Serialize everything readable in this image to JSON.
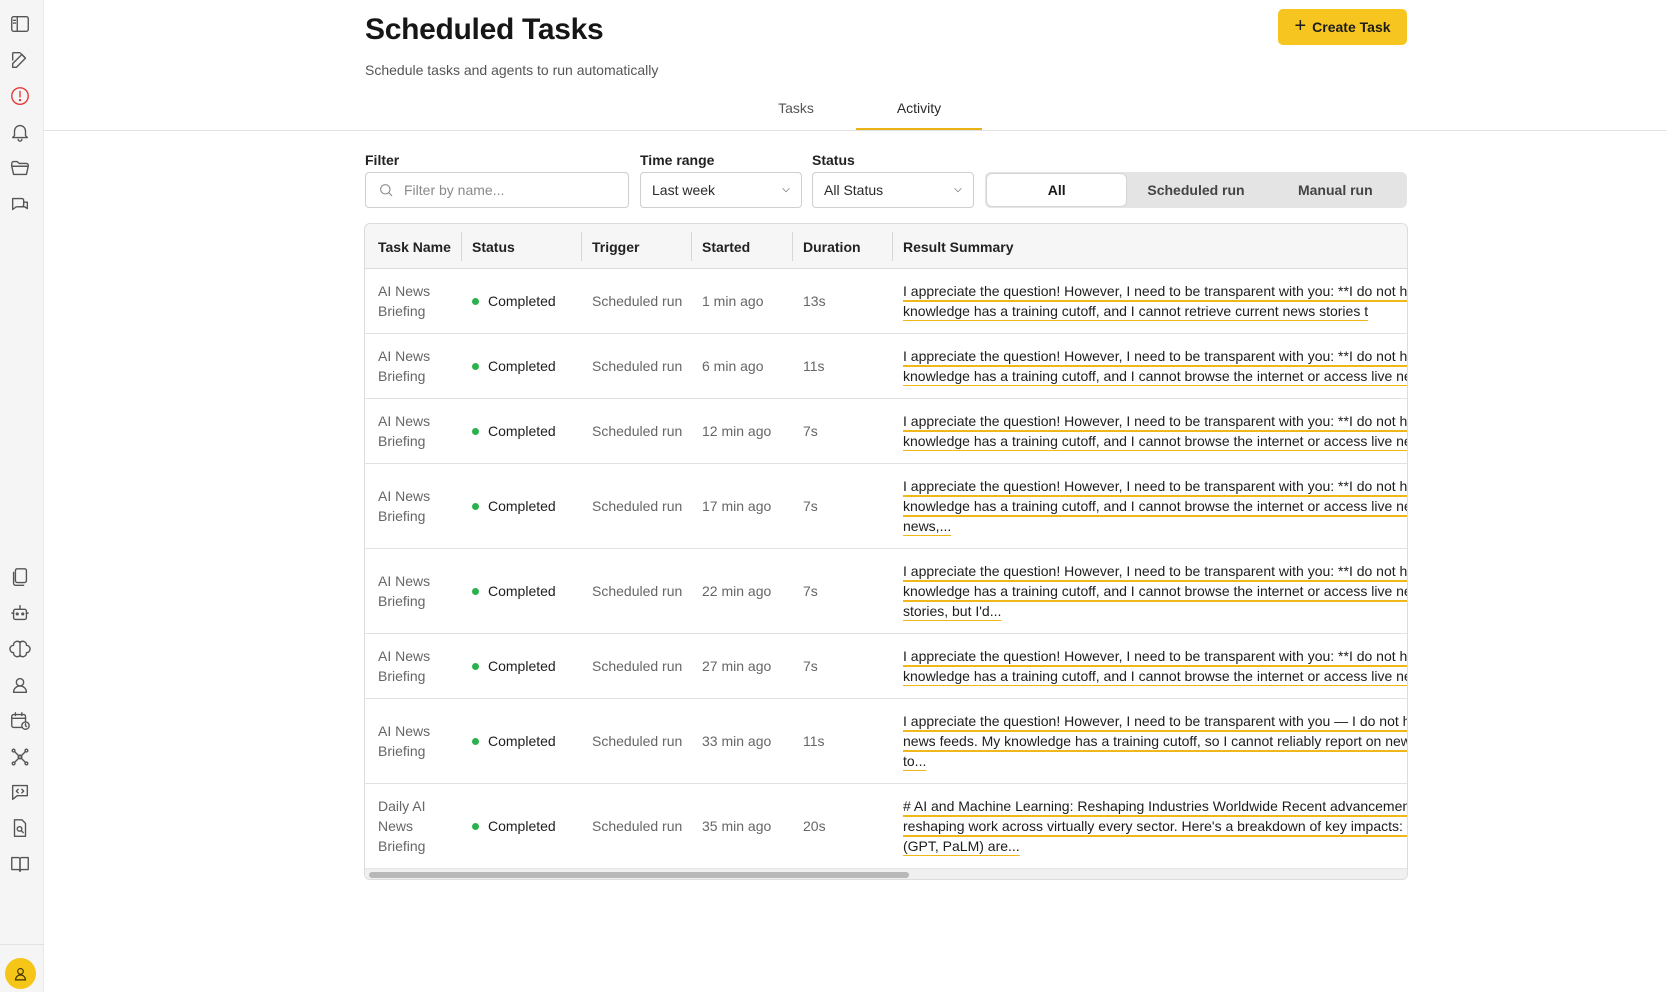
{
  "header": {
    "title": "Scheduled Tasks",
    "subtitle": "Schedule tasks and agents to run automatically",
    "create_label": "Create Task"
  },
  "tabs": [
    {
      "label": "Tasks",
      "active": false
    },
    {
      "label": "Activity",
      "active": true
    }
  ],
  "filters": {
    "filter_label": "Filter",
    "filter_placeholder": "Filter by name...",
    "time_label": "Time range",
    "time_value": "Last week",
    "status_label": "Status",
    "status_value": "All Status",
    "segments": [
      "All",
      "Scheduled run",
      "Manual run"
    ],
    "active_segment": "All"
  },
  "table": {
    "columns": [
      "Task Name",
      "Status",
      "Trigger",
      "Started",
      "Duration",
      "Result Summary"
    ],
    "rows": [
      {
        "name_1": "AI News",
        "name_2": "Briefing",
        "name_3": "",
        "status": "Completed",
        "trigger": "Scheduled run",
        "started": "1 min ago",
        "duration": "13s",
        "result": "I appreciate the question! However, I need to be transparent with you: **I do not have real-time internet access. My knowledge has a training cutoff, and I cannot retrieve current news stories t"
      },
      {
        "name_1": "AI News",
        "name_2": "Briefing",
        "name_3": "",
        "status": "Completed",
        "trigger": "Scheduled run",
        "started": "6 min ago",
        "duration": "11s",
        "result": "I appreciate the question! However, I need to be transparent with you: **I do not have real-time internet access. My knowledge has a training cutoff, and I cannot browse the internet or access live news feeds t"
      },
      {
        "name_1": "AI News",
        "name_2": "Briefing",
        "name_3": "",
        "status": "Completed",
        "trigger": "Scheduled run",
        "started": "12 min ago",
        "duration": "7s",
        "result": "I appreciate the question! However, I need to be transparent with you: **I do not have real-time internet access. My knowledge has a training cutoff, and I cannot browse the internet or access live news feeds t"
      },
      {
        "name_1": "AI News",
        "name_2": "Briefing",
        "name_3": "",
        "status": "Completed",
        "trigger": "Scheduled run",
        "started": "17 min ago",
        "duration": "7s",
        "result": "I appreciate the question! However, I need to be transparent with you: **I do not have real-time internet access. My knowledge has a training cutoff, and I cannot browse the internet or access live news feeds to retrieve today's AI news,..."
      },
      {
        "name_1": "AI News",
        "name_2": "Briefing",
        "name_3": "",
        "status": "Completed",
        "trigger": "Scheduled run",
        "started": "22 min ago",
        "duration": "7s",
        "result": "I appreciate the question! However, I need to be transparent with you: **I do not have real-time internet access. My knowledge has a training cutoff, and I cannot browse the internet or access live news feeds to retrieve the latest stories, but I'd..."
      },
      {
        "name_1": "AI News",
        "name_2": "Briefing",
        "name_3": "",
        "status": "Completed",
        "trigger": "Scheduled run",
        "started": "27 min ago",
        "duration": "7s",
        "result": "I appreciate the question! However, I need to be transparent with you: **I do not have real-time internet access. My knowledge has a training cutoff, and I cannot browse the internet or access live news feeds t"
      },
      {
        "name_1": "AI News",
        "name_2": "Briefing",
        "name_3": "",
        "status": "Completed",
        "trigger": "Scheduled run",
        "started": "33 min ago",
        "duration": "11s",
        "result": "I appreciate the question! However, I need to be transparent with you — I do not have access to the internet or live news feeds. My knowledge has a training cutoff, so I cannot reliably report on news from today. I would recommend to..."
      },
      {
        "name_1": "Daily AI",
        "name_2": "News",
        "name_3": "Briefing",
        "status": "Completed",
        "trigger": "Scheduled run",
        "started": "35 min ago",
        "duration": "20s",
        "result": "# AI and Machine Learning: Reshaping Industries Worldwide Recent advancements in artificial intelligence are reshaping work across virtually every sector. Here's a breakdown of key impacts: --- ## 🏥 Large language models (GPT, PaLM) are..."
      }
    ]
  },
  "colors": {
    "accent": "#f7c520",
    "status_ok": "#2bb24c",
    "alert": "#e53935"
  }
}
